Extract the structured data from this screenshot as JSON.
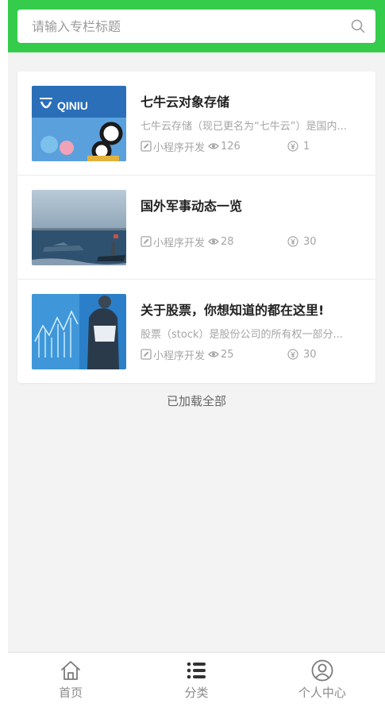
{
  "search": {
    "placeholder": "请输入专栏标题",
    "value": ""
  },
  "colors": {
    "header": "#35cc4b",
    "background": "#f3f3f3"
  },
  "articles": [
    {
      "title": "七牛云对象存储",
      "desc": "七牛云存储（现已更名为“七牛云”）是国内...",
      "category": "小程序开发",
      "views": "126",
      "price": "1",
      "thumbnail_text": "QINIU"
    },
    {
      "title": "国外军事动态一览",
      "desc": "",
      "category": "小程序开发",
      "views": "28",
      "price": "30"
    },
    {
      "title": "关于股票，你想知道的都在这里!",
      "desc": "股票（stock）是股份公司的所有权一部分...",
      "category": "小程序开发",
      "views": "25",
      "price": "30"
    }
  ],
  "footer_text": "已加载全部",
  "tabs": [
    {
      "label": "首页",
      "icon": "home-icon"
    },
    {
      "label": "分类",
      "icon": "list-icon"
    },
    {
      "label": "个人中心",
      "icon": "user-icon"
    }
  ]
}
